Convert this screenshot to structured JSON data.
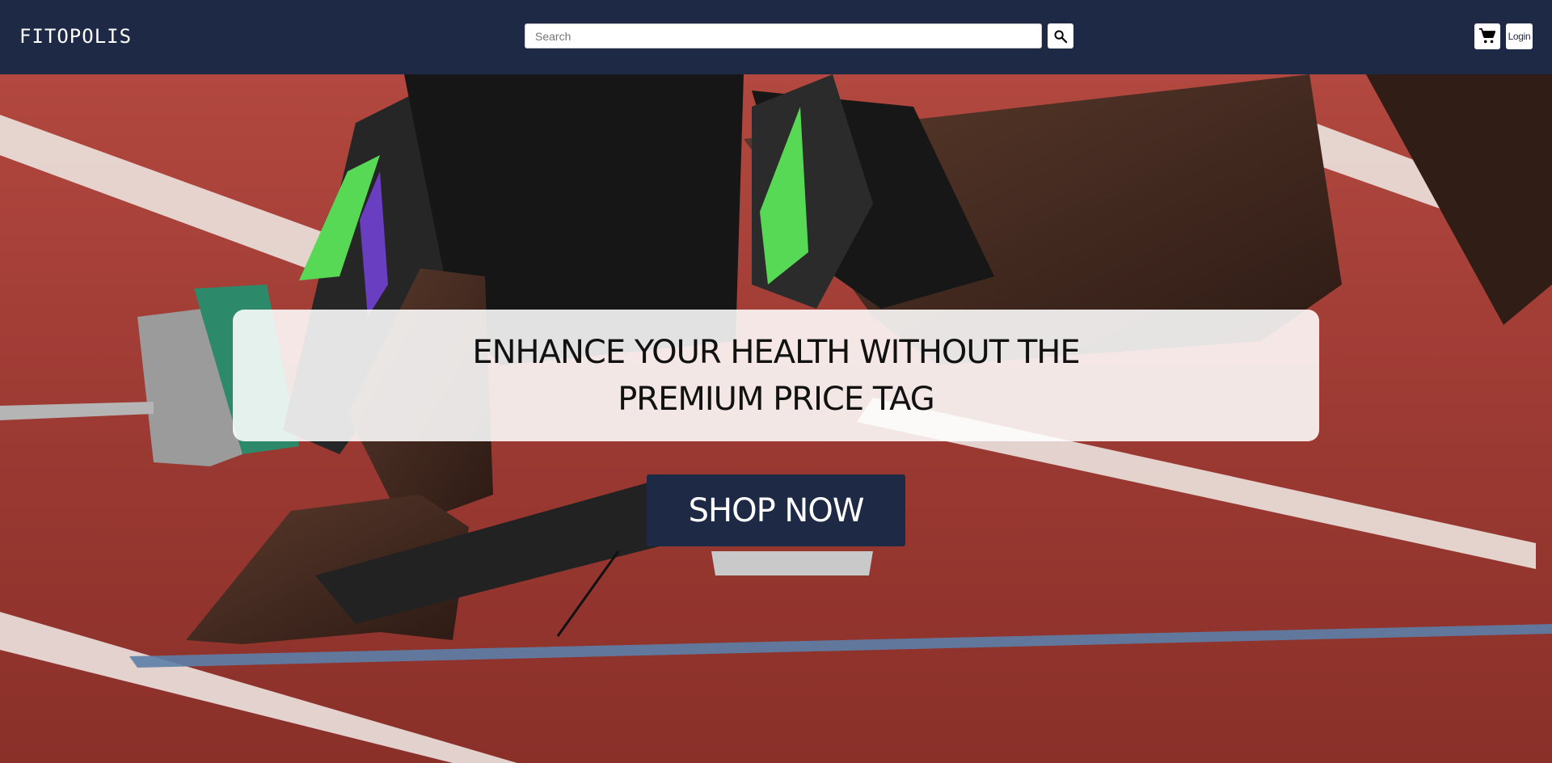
{
  "header": {
    "logo": "FITOPOLIS",
    "search_placeholder": "Search",
    "search_icon": "search-icon",
    "cart_icon": "shopping-cart-icon",
    "login_label": "Login"
  },
  "hero": {
    "background_image": "sprinter-starting-block-on-track",
    "headline": "ENHANCE YOUR HEALTH WITHOUT THE PREMIUM PRICE TAG",
    "cta_label": "SHOP NOW"
  },
  "colors": {
    "nav_bg": "#1e2945",
    "track": "#9a3a33",
    "lane_line": "#f2ece8",
    "cta_bg": "#1e2945"
  }
}
